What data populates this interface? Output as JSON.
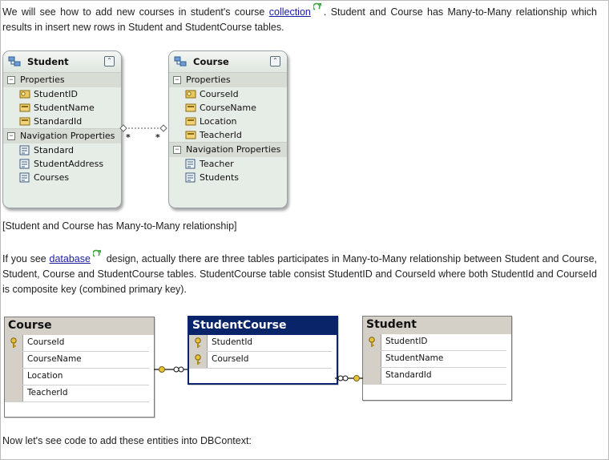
{
  "paragraph1": {
    "before": "We will see how to add new courses in student's course ",
    "link": "collection",
    "after": ". Student and Course has Many-to-Many relationship which results in insert new rows in Student and StudentCourse tables."
  },
  "model_diagram": {
    "student": {
      "title": "Student",
      "properties_label": "Properties",
      "properties": [
        "StudentID",
        "StudentName",
        "StandardId"
      ],
      "navigation_label": "Navigation Properties",
      "navigation": [
        "Standard",
        "StudentAddress",
        "Courses"
      ]
    },
    "course": {
      "title": "Course",
      "properties_label": "Properties",
      "properties": [
        "CourseId",
        "CourseName",
        "Location",
        "TeacherId"
      ],
      "navigation_label": "Navigation Properties",
      "navigation": [
        "Teacher",
        "Students"
      ]
    },
    "multiplicity_left": "*",
    "multiplicity_right": "*",
    "collapse_glyph": "⌃",
    "section_glyph": "−"
  },
  "caption": "[Student and Course has Many-to-Many relationship]",
  "paragraph2": {
    "before": "If you see ",
    "link": "database",
    "after": " design, actually there are three tables participates in Many-to-Many relationship between Student and Course, Student, Course and StudentCourse tables. StudentCourse table consist StudentID and CourseId where both StudentId and CourseId is composite key (combined primary key)."
  },
  "db_diagram": {
    "course_table": {
      "title": "Course",
      "columns": [
        "CourseId",
        "CourseName",
        "Location",
        "TeacherId"
      ],
      "key_rows": [
        0
      ]
    },
    "studentcourse_table": {
      "title": "StudentCourse",
      "columns": [
        "StudentId",
        "CourseId"
      ],
      "key_rows": [
        0,
        1
      ]
    },
    "student_table": {
      "title": "Student",
      "columns": [
        "StudentID",
        "StudentName",
        "StandardId"
      ],
      "key_rows": [
        0
      ]
    }
  },
  "paragraph3": "Now let's see code to add these entities into DBContext:",
  "colors": {
    "link": "#1a1aa6",
    "selected_table_header": "#0a246a",
    "entity_bg": "#e6ece6",
    "external_icon": "#3aa83a"
  }
}
